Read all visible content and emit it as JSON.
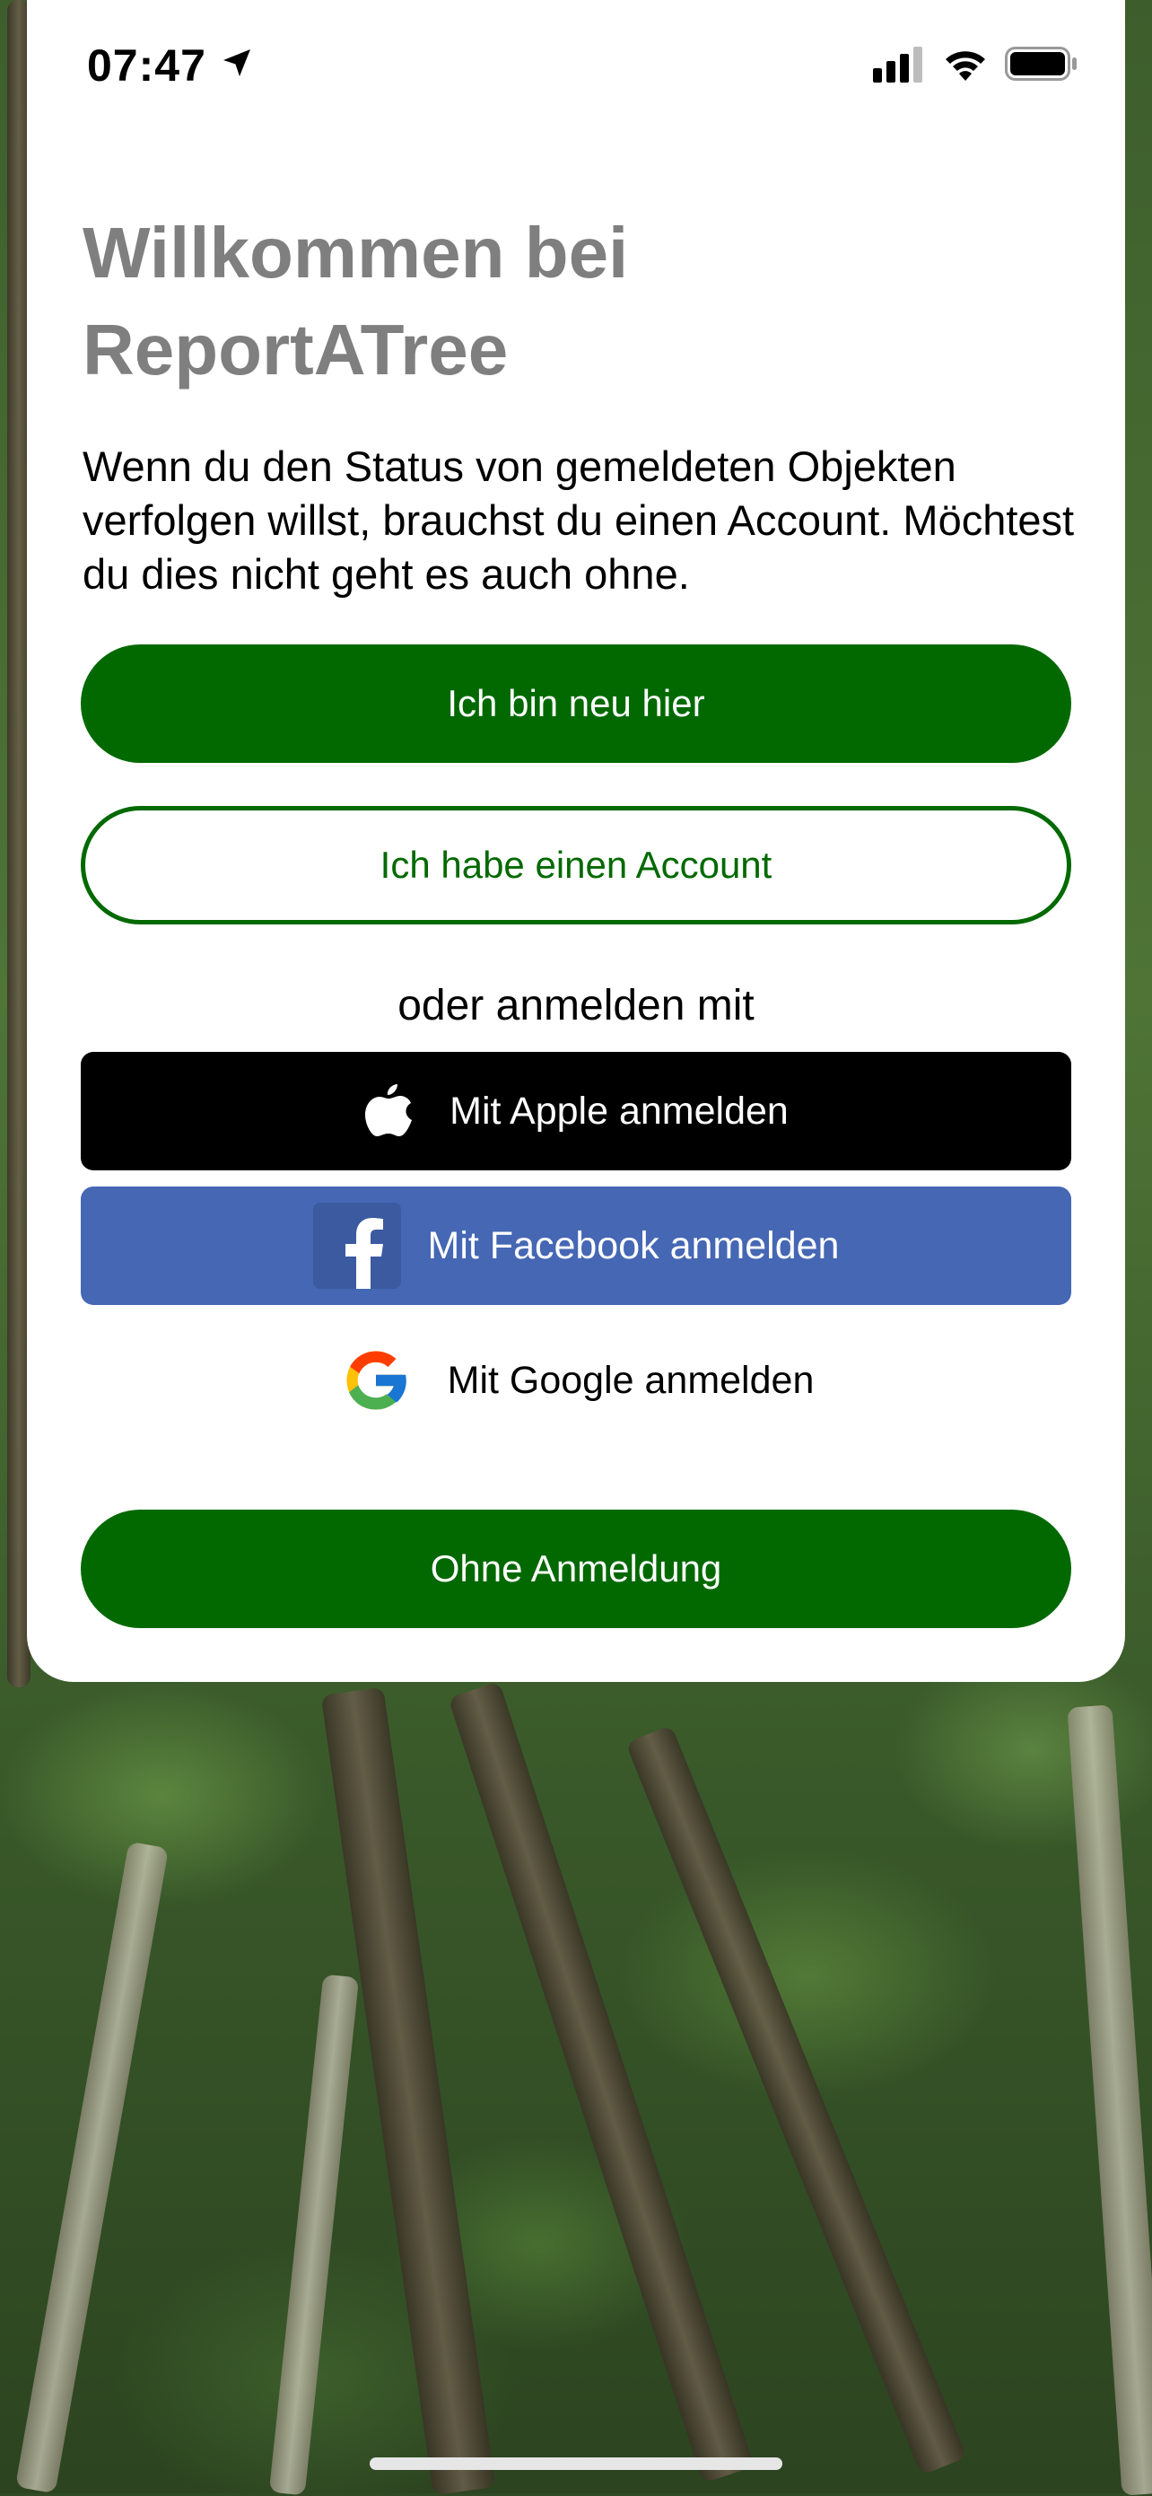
{
  "status_bar": {
    "time": "07:47",
    "icons": [
      "location-arrow-icon",
      "cellular-signal-icon",
      "wifi-icon",
      "battery-icon"
    ]
  },
  "welcome": {
    "title_line1": "Willkommen bei",
    "title_line2": "ReportATree",
    "description": "Wenn du den Status von gemeldeten Objekten verfolgen willst, brauchst du einen Account. Möchtest du dies nicht geht es auch ohne."
  },
  "buttons": {
    "new_here": "Ich bin neu hier",
    "have_account": "Ich habe einen Account",
    "or_login_with": "oder anmelden mit",
    "apple": "Mit Apple anmelden",
    "facebook": "Mit Facebook anmelden",
    "google": "Mit Google anmelden",
    "without_login": "Ohne Anmeldung"
  },
  "colors": {
    "primary_green": "#026900",
    "facebook_blue": "#4567b4",
    "title_gray": "#7f7f7f"
  }
}
